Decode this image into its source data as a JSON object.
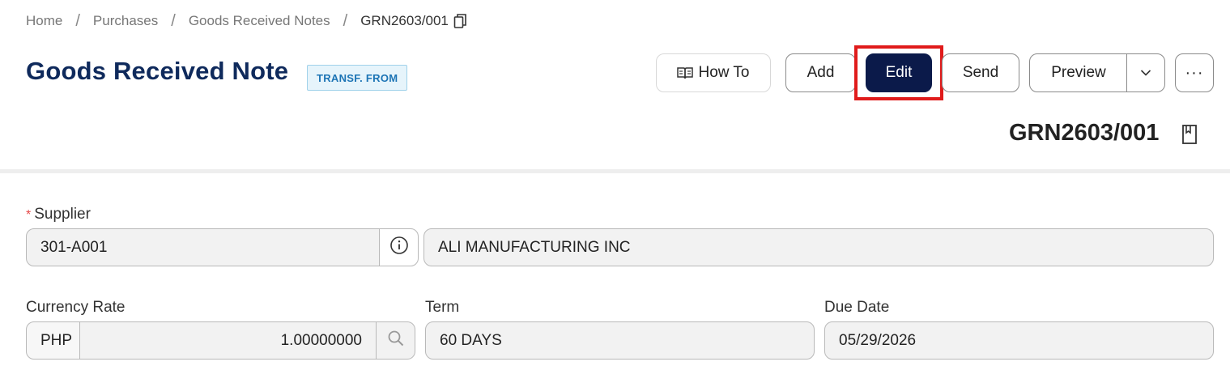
{
  "breadcrumb": {
    "items": [
      "Home",
      "Purchases",
      "Goods Received Notes"
    ],
    "separator": "/",
    "current": "GRN2603/001"
  },
  "header": {
    "title": "Goods Received Note",
    "badge": "TRANSF. FROM"
  },
  "toolbar": {
    "how_to_label": "How To",
    "add_label": "Add",
    "edit_label": "Edit",
    "send_label": "Send",
    "preview_label": "Preview",
    "more_label": "···"
  },
  "document": {
    "number": "GRN2603/001"
  },
  "form": {
    "supplier": {
      "label": "Supplier",
      "required_mark": "*",
      "code": "301-A001",
      "name": "ALI MANUFACTURING INC"
    },
    "currency_rate": {
      "label": "Currency Rate",
      "currency": "PHP",
      "rate": "1.00000000"
    },
    "term": {
      "label": "Term",
      "value": "60 DAYS"
    },
    "due_date": {
      "label": "Due Date",
      "value": "05/29/2026"
    }
  },
  "colors": {
    "title": "#0f2a5c",
    "primary_button": "#0b1a4a",
    "highlight": "#e01b1b",
    "badge_text": "#1c74b5",
    "badge_bg": "#e6f4fb"
  },
  "icons": [
    "copy-icon",
    "book-icon",
    "chevron-down-icon",
    "bookmark-icon",
    "info-icon",
    "search-icon"
  ]
}
